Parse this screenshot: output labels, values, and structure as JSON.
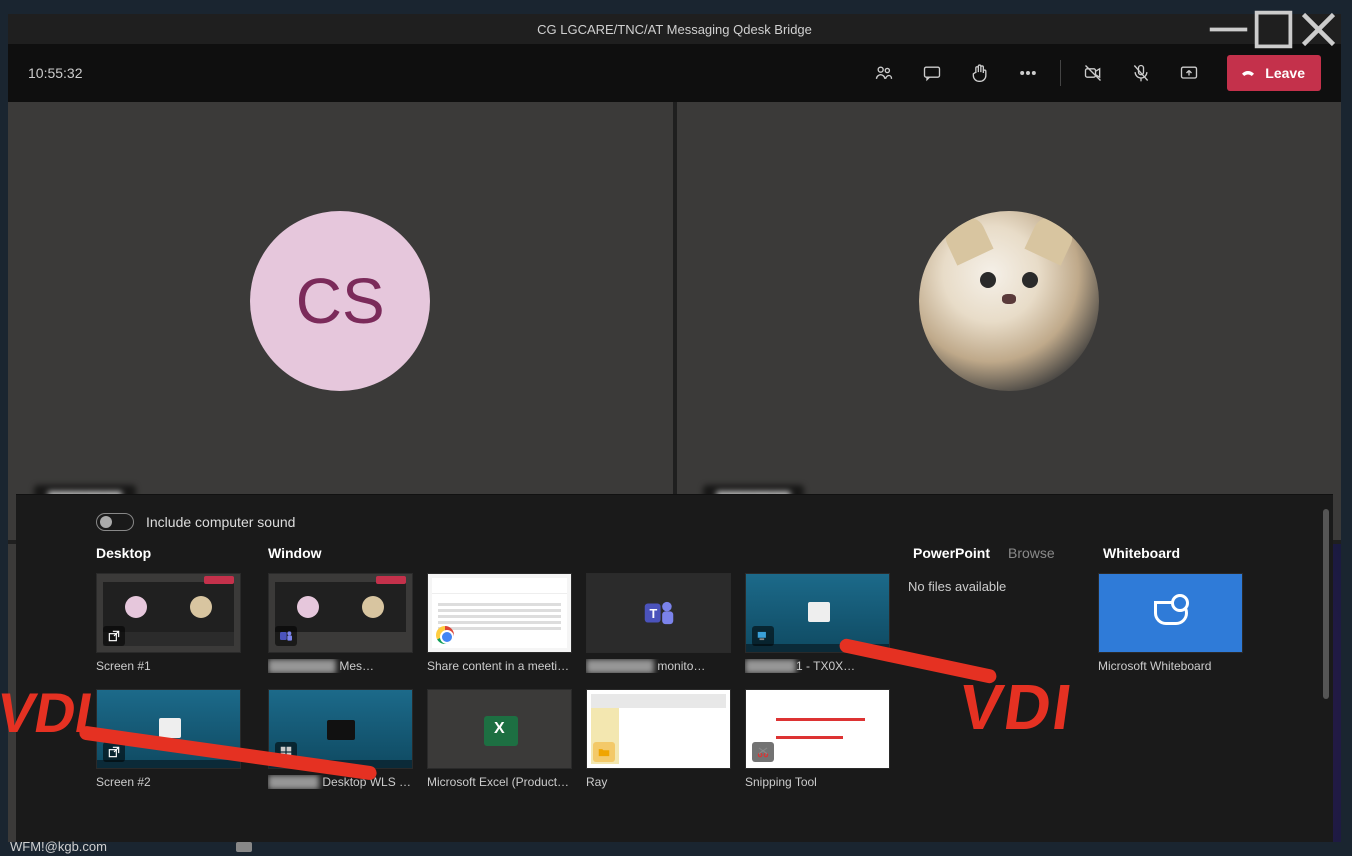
{
  "window": {
    "title": "CG LGCARE/TNC/AT Messaging Qdesk Bridge"
  },
  "topbar": {
    "clock": "10:55:32",
    "leave_label": "Leave"
  },
  "participants": [
    {
      "initials": "CS",
      "name": "████████"
    },
    {
      "initials": "",
      "name": "████████"
    }
  ],
  "share_tray": {
    "include_sound_label": "Include computer sound",
    "headers": {
      "desktop": "Desktop",
      "window": "Window",
      "powerpoint": "PowerPoint",
      "browse": "Browse",
      "whiteboard": "Whiteboard"
    },
    "powerpoint_nofiles": "No files available",
    "desktop_items": [
      {
        "label": "Screen #1"
      },
      {
        "label": "Screen #2"
      }
    ],
    "window_items_row1": [
      {
        "label": "████████ Mes…"
      },
      {
        "label": "Share content in a meeti…"
      },
      {
        "label": "████████ monito…"
      },
      {
        "label": "████████1 - TX0X…"
      }
    ],
    "window_items_row2": [
      {
        "label": "██████ Desktop WLS Co…"
      },
      {
        "label": "Microsoft Excel (Product…"
      },
      {
        "label": "Ray"
      },
      {
        "label": "Snipping Tool"
      }
    ],
    "whiteboard_item": {
      "label": "Microsoft Whiteboard"
    }
  },
  "footer": {
    "email": "WFM!@kgb.com"
  },
  "annotations": {
    "text": "VDI"
  }
}
